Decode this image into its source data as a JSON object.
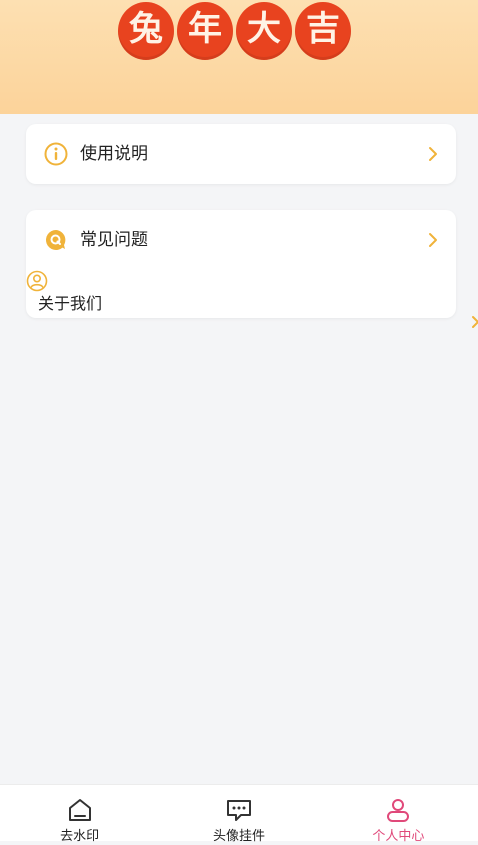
{
  "banner": {
    "chars": [
      "兔",
      "年",
      "大",
      "吉"
    ]
  },
  "menu": {
    "usage_label": "使用说明",
    "faq_label": "常见问题",
    "about_label": "关于我们"
  },
  "tabs": [
    {
      "label": "去水印",
      "icon": "home-icon",
      "active": false
    },
    {
      "label": "头像挂件",
      "icon": "message-icon",
      "active": false
    },
    {
      "label": "个人中心",
      "icon": "user-icon",
      "active": true
    }
  ],
  "colors": {
    "accent": "#f0b33a",
    "active_tab": "#e0497a",
    "banner_bg": "#fcd39a",
    "banner_char": "#e8431f"
  }
}
